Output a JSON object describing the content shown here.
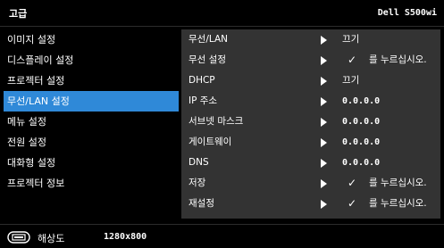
{
  "header": {
    "title": "고급",
    "model": "Dell S500wi"
  },
  "sidebar": {
    "items": [
      {
        "label": "이미지 설정"
      },
      {
        "label": "디스플레이 설정"
      },
      {
        "label": "프로젝터 설정"
      },
      {
        "label": "무선/LAN 설정",
        "selected": true
      },
      {
        "label": "메뉴 설정"
      },
      {
        "label": "전원 설정"
      },
      {
        "label": "대화형 설정"
      },
      {
        "label": "프로젝터 정보"
      }
    ]
  },
  "settings": {
    "rows": [
      {
        "label": "무선/LAN",
        "value": "끄기"
      },
      {
        "label": "무선 설정",
        "check": "✓",
        "value": "를 누르십시오."
      },
      {
        "label": "DHCP",
        "value": "끄기"
      },
      {
        "label": "IP 주소",
        "value": "0.0.0.0"
      },
      {
        "label": "서브넷 마스크",
        "value": "0.0.0.0"
      },
      {
        "label": "게이트웨이",
        "value": "0.0.0.0"
      },
      {
        "label": "DNS",
        "value": "0.0.0.0"
      },
      {
        "label": "저장",
        "check": "✓",
        "value": "를 누르십시오."
      },
      {
        "label": "재설정",
        "check": "✓",
        "value": "를 누르십시오."
      }
    ]
  },
  "footer": {
    "icon": "resolution-icon",
    "label": "해상도",
    "value": "1280x800"
  },
  "colors": {
    "selected": "#2f89d8",
    "panel": "#333333",
    "background": "#000000"
  }
}
